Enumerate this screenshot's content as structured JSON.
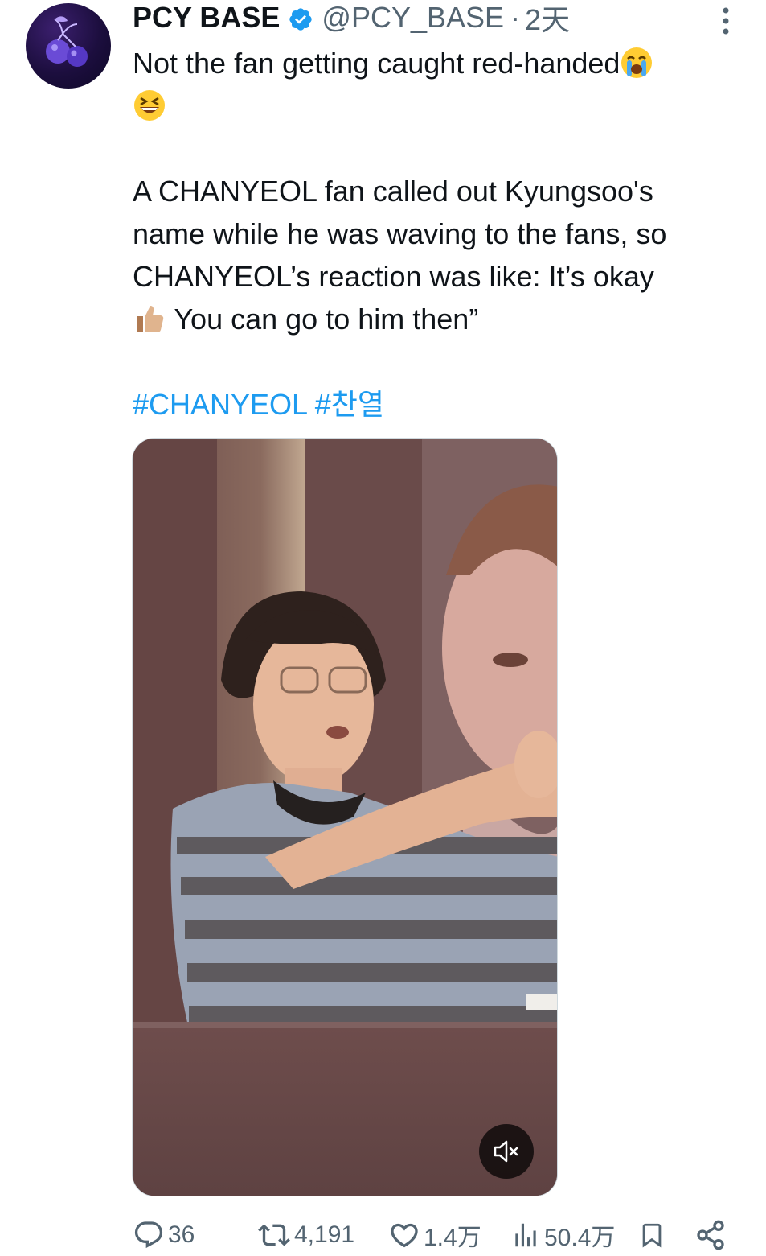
{
  "tweet": {
    "author": {
      "display_name": "PCY BASE",
      "handle": "@PCY_BASE",
      "verified": true,
      "avatar_icon": "cherry-icon"
    },
    "separator": "·",
    "time": "2天",
    "text_lines": [
      "Not the fan getting caught red-handed",
      "",
      "",
      "A CHANYEOL fan called out Kyungsoo's",
      "name while he was waving to the fans, so",
      "CHANYEOL’s reaction was like: It’s okay",
      " You can go to him then”"
    ],
    "emojis": [
      "loudly-crying-face-emoji",
      "grinning-squinting-face-emoji",
      "thumbs-up-emoji"
    ],
    "hashtags": [
      "#CHANYEOL",
      "#찬열"
    ]
  },
  "media": {
    "type": "video",
    "mute_icon": "speaker-muted-icon"
  },
  "actions": {
    "reply_count": "36",
    "retweet_count": "4,191",
    "like_count": "1.4万",
    "view_count": "50.4万"
  },
  "colors": {
    "text": "#0f1419",
    "secondary": "#536471",
    "link": "#1d9bf0",
    "verified": "#1d9bf0"
  }
}
